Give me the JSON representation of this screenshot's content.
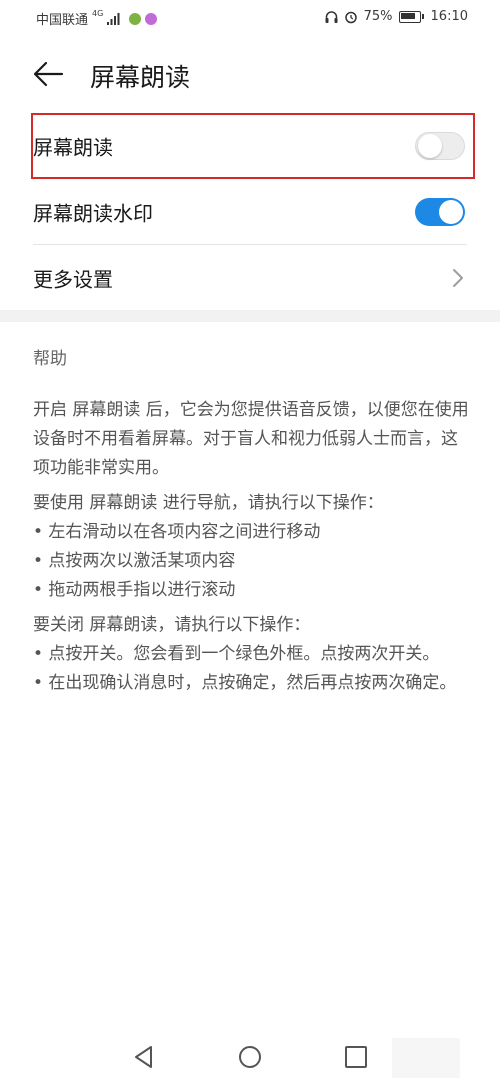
{
  "status_bar": {
    "carrier": "中国联通",
    "network": "4G",
    "battery": "75%",
    "time": "16:10"
  },
  "header": {
    "title": "屏幕朗读"
  },
  "settings": {
    "screen_reader": {
      "label": "屏幕朗读",
      "enabled": false
    },
    "watermark": {
      "label": "屏幕朗读水印",
      "enabled": true
    },
    "more": {
      "label": "更多设置"
    }
  },
  "help": {
    "title": "帮助",
    "intro": "开启 屏幕朗读 后，它会为您提供语音反馈，以便您在使用设备时不用看着屏幕。对于盲人和视力低弱人士而言，这项功能非常实用。",
    "navigate_heading": "要使用 屏幕朗读 进行导航，请执行以下操作：",
    "navigate_steps": [
      "• 左右滑动以在各项内容之间进行移动",
      "• 点按两次以激活某项内容",
      "• 拖动两根手指以进行滚动"
    ],
    "close_heading": "要关闭 屏幕朗读，请执行以下操作：",
    "close_steps": [
      "• 点按开关。您会看到一个绿色外框。点按两次开关。",
      "• 在出现确认消息时，点按确定，然后再点按两次确定。"
    ]
  },
  "colors": {
    "accent": "#1e88e5",
    "highlight": "#d42a2a"
  }
}
